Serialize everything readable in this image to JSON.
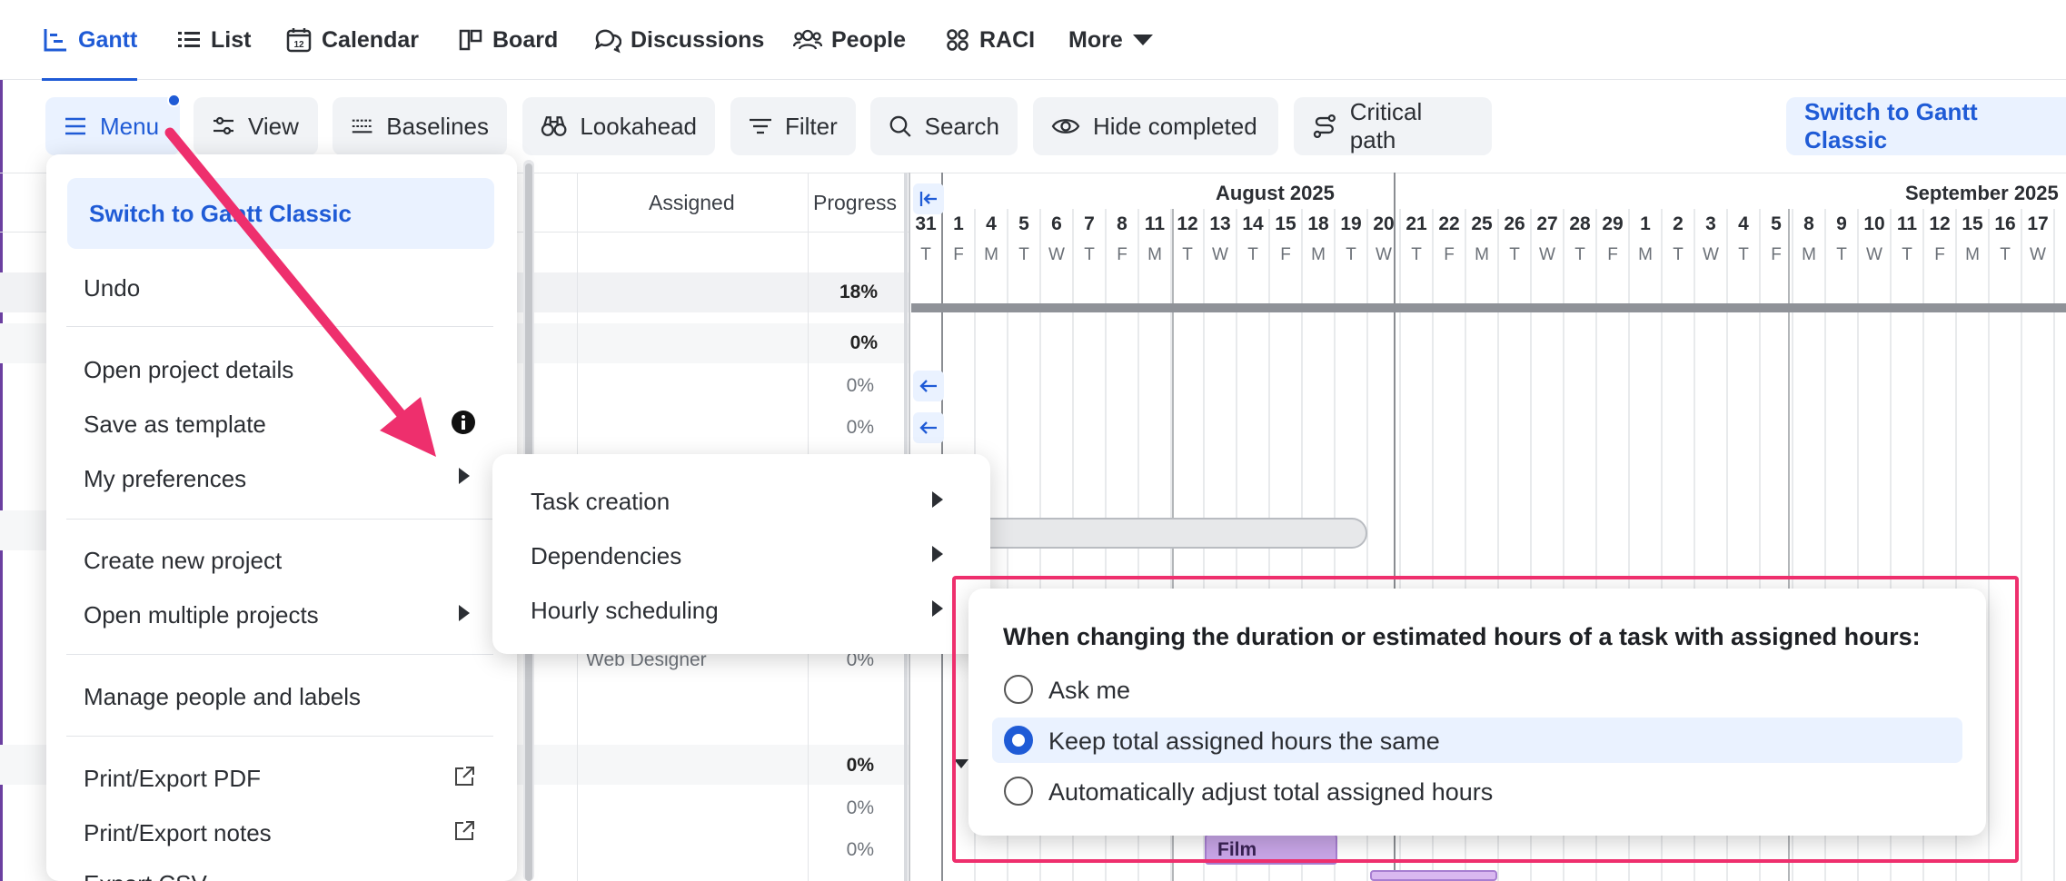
{
  "nav": {
    "tabs": [
      {
        "label": "Gantt",
        "icon": "gantt-icon"
      },
      {
        "label": "List",
        "icon": "list-icon"
      },
      {
        "label": "Calendar",
        "icon": "calendar-icon"
      },
      {
        "label": "Board",
        "icon": "board-icon"
      },
      {
        "label": "Discussions",
        "icon": "discussions-icon"
      },
      {
        "label": "People",
        "icon": "people-icon"
      },
      {
        "label": "RACI",
        "icon": "raci-icon"
      },
      {
        "label": "More",
        "icon": "caret-down-icon"
      }
    ],
    "active_tab": "Gantt",
    "calendar_icon_text": "12"
  },
  "toolbar": {
    "menu": "Menu",
    "view": "View",
    "baselines": "Baselines",
    "lookahead": "Lookahead",
    "filter": "Filter",
    "search": "Search",
    "hide_completed": "Hide completed",
    "critical_path": "Critical path",
    "switch_classic": "Switch to Gantt Classic"
  },
  "table": {
    "headers": {
      "assigned": "Assigned",
      "progress": "Progress"
    },
    "progress_values": [
      "18%",
      "0%",
      "0%",
      "0%",
      "0%",
      "0%",
      "0%",
      "0%"
    ],
    "assigned_values": [
      "Web Designer"
    ]
  },
  "gantt": {
    "months": [
      "August 2025",
      "September 2025"
    ],
    "days": [
      {
        "n": "31",
        "d": "T"
      },
      {
        "n": "1",
        "d": "F"
      },
      {
        "n": "4",
        "d": "M"
      },
      {
        "n": "5",
        "d": "T"
      },
      {
        "n": "6",
        "d": "W"
      },
      {
        "n": "7",
        "d": "T"
      },
      {
        "n": "8",
        "d": "F"
      },
      {
        "n": "11",
        "d": "M"
      },
      {
        "n": "12",
        "d": "T"
      },
      {
        "n": "13",
        "d": "W"
      },
      {
        "n": "14",
        "d": "T"
      },
      {
        "n": "15",
        "d": "F"
      },
      {
        "n": "18",
        "d": "M"
      },
      {
        "n": "19",
        "d": "T"
      },
      {
        "n": "20",
        "d": "W"
      },
      {
        "n": "21",
        "d": "T"
      },
      {
        "n": "22",
        "d": "F"
      },
      {
        "n": "25",
        "d": "M"
      },
      {
        "n": "26",
        "d": "T"
      },
      {
        "n": "27",
        "d": "W"
      },
      {
        "n": "28",
        "d": "T"
      },
      {
        "n": "29",
        "d": "F"
      },
      {
        "n": "1",
        "d": "M"
      },
      {
        "n": "2",
        "d": "T"
      },
      {
        "n": "3",
        "d": "W"
      },
      {
        "n": "4",
        "d": "T"
      },
      {
        "n": "5",
        "d": "F"
      },
      {
        "n": "8",
        "d": "M"
      },
      {
        "n": "9",
        "d": "T"
      },
      {
        "n": "10",
        "d": "W"
      },
      {
        "n": "11",
        "d": "T"
      },
      {
        "n": "12",
        "d": "F"
      },
      {
        "n": "15",
        "d": "M"
      },
      {
        "n": "16",
        "d": "T"
      },
      {
        "n": "17",
        "d": "W"
      }
    ],
    "task_label": "Film"
  },
  "menu": {
    "switch_classic": "Switch to Gantt Classic",
    "undo": "Undo",
    "open_project_details": "Open project details",
    "save_as_template": "Save as template",
    "my_preferences": "My preferences",
    "create_new_project": "Create new project",
    "open_multiple_projects": "Open multiple projects",
    "manage_people_labels": "Manage people and labels",
    "print_export_pdf": "Print/Export PDF",
    "print_export_notes": "Print/Export notes",
    "export_csv": "Export CSV"
  },
  "submenu": {
    "task_creation": "Task creation",
    "dependencies": "Dependencies",
    "hourly_scheduling": "Hourly scheduling"
  },
  "popup": {
    "title": "When changing the duration or estimated hours of a task with assigned hours:",
    "options": [
      "Ask me",
      "Keep total assigned hours the same",
      "Automatically adjust total assigned hours"
    ],
    "selected": "Keep total assigned hours the same"
  },
  "colors": {
    "accent": "#1f5bd6",
    "annotation": "#ee2f6d",
    "task_bar": "#c9a6e8"
  }
}
